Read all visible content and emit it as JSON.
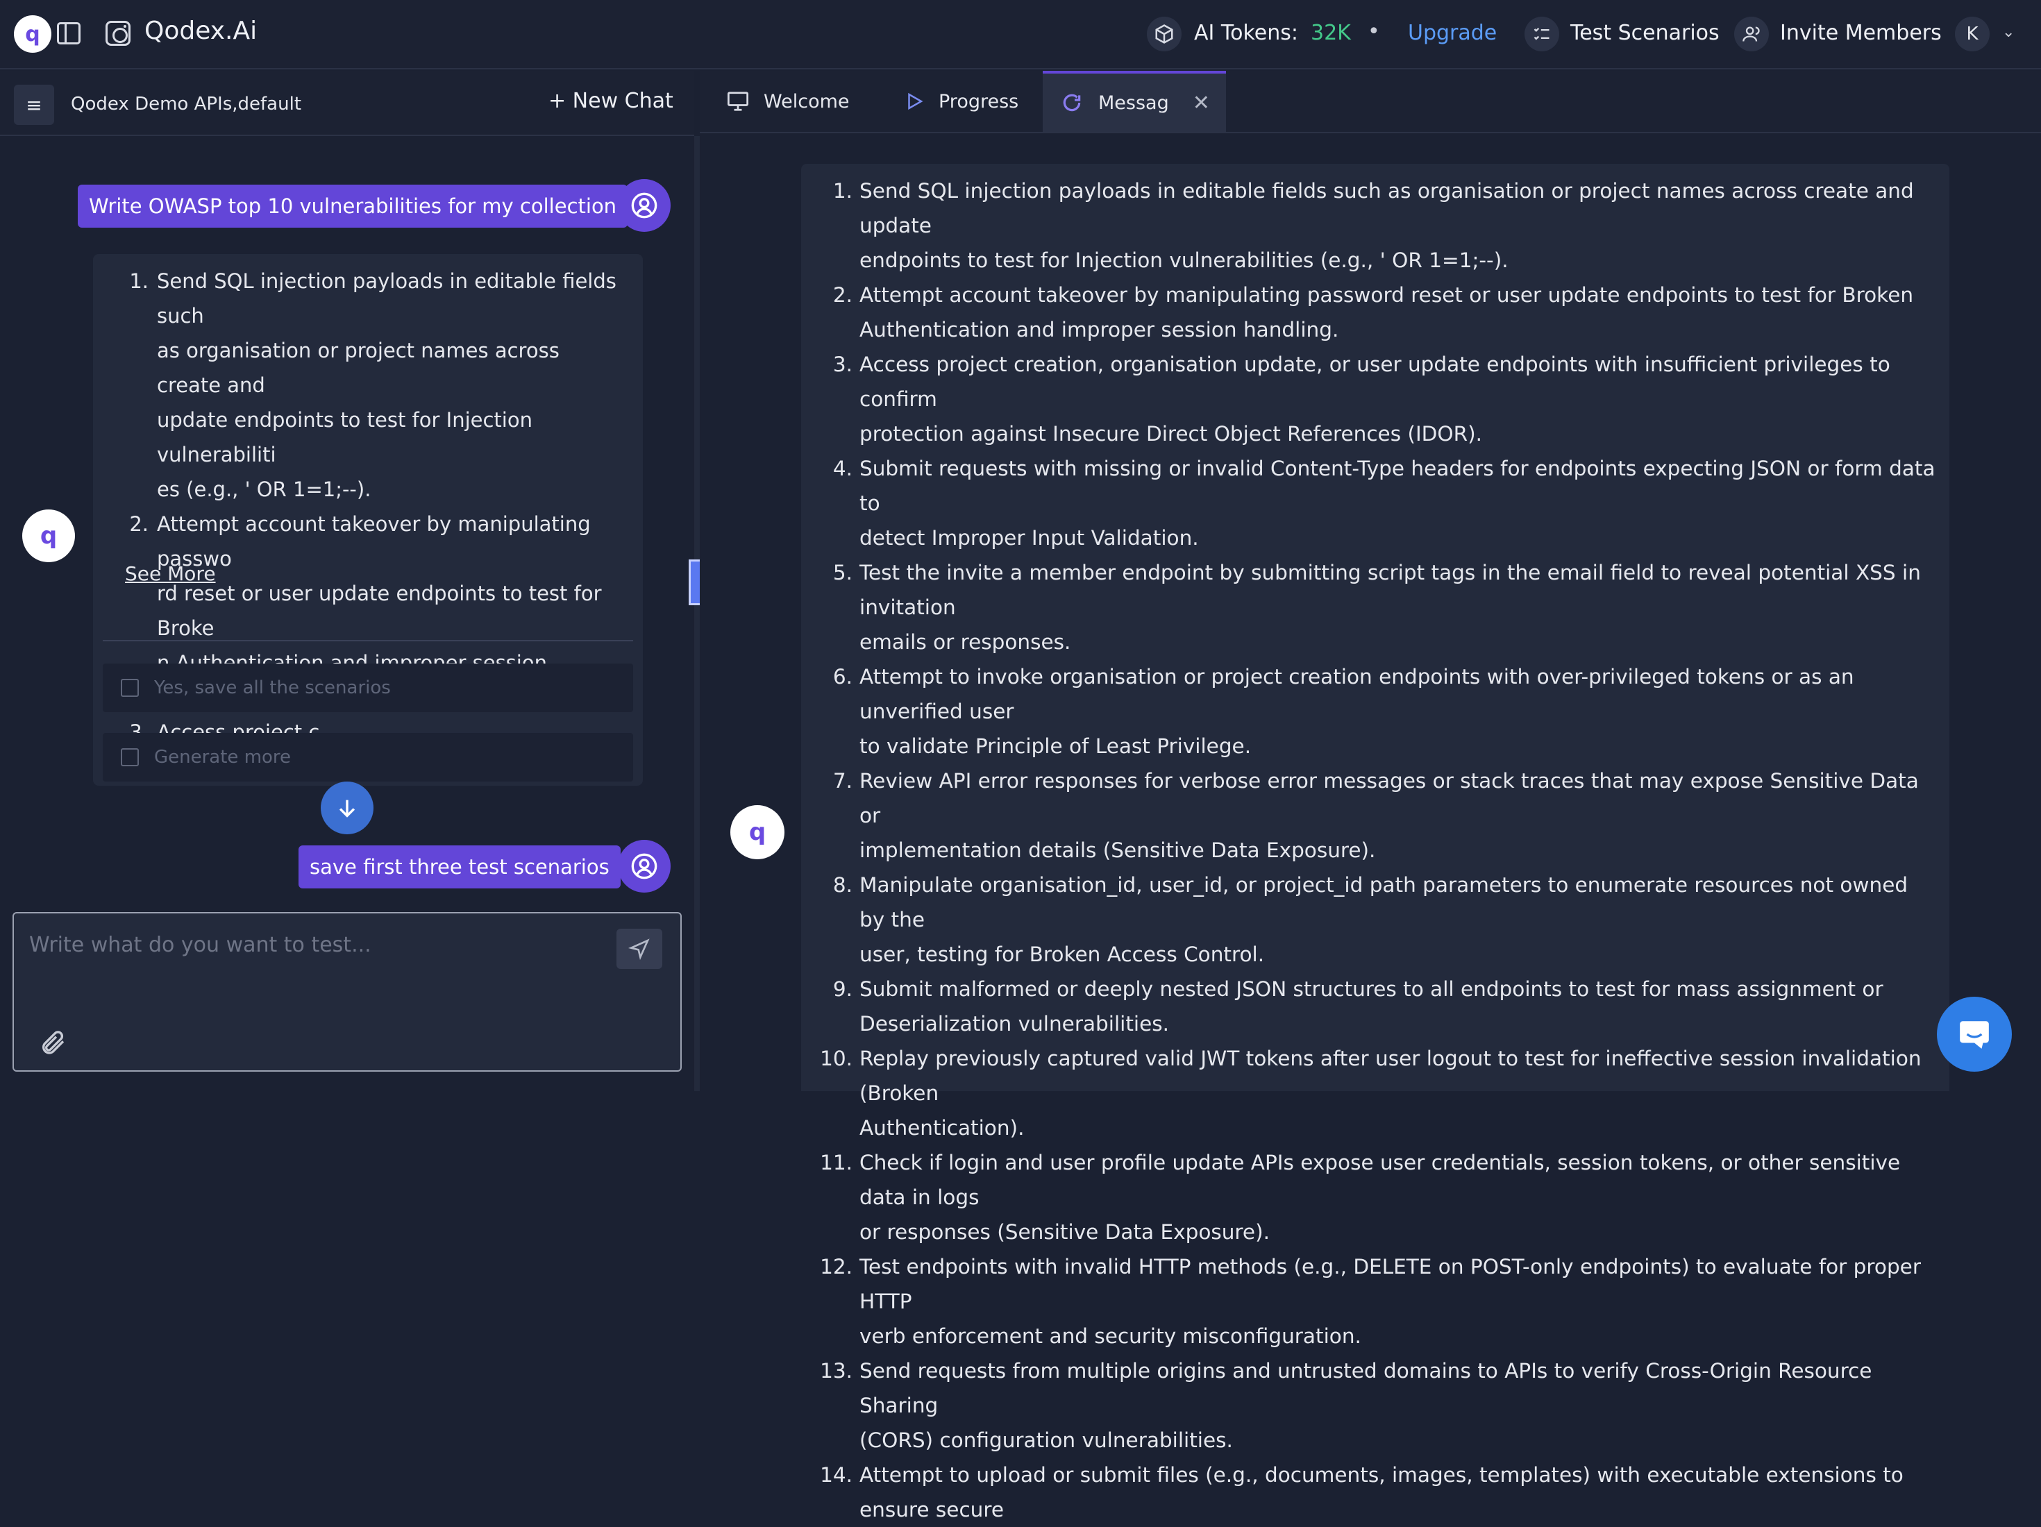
{
  "topbar": {
    "logo_letter": "q",
    "brand": "Qodex.Ai",
    "tokens_label": "AI Tokens:",
    "tokens_value": "32K",
    "separator": "•",
    "upgrade": "Upgrade",
    "test_scenarios": "Test Scenarios",
    "invite_members": "Invite Members",
    "avatar_initial": "K",
    "accent_color": "#6346d8",
    "tokens_color": "#44c98a",
    "link_color": "#5b9cf6"
  },
  "left": {
    "menu_icon": "≡",
    "collection": "Qodex Demo APIs,default",
    "new_chat": "+ New Chat",
    "messages": {
      "first_user": "Write OWASP top 10 vulnerabilities for my collection",
      "second_user": "save first three test scenarios"
    },
    "bot_list": [
      {
        "num": "1.",
        "lines": [
          "Send SQL injection payloads in editable fields such",
          "as organisation or project names across create and",
          "update endpoints to test for Injection vulnerabiliti",
          "es (e.g., ' OR 1=1;--)."
        ]
      },
      {
        "num": "2.",
        "lines": [
          "Attempt account takeover by manipulating passwo",
          "rd reset or user update endpoints to test for Broke",
          "n Authentication and improper session handling."
        ]
      },
      {
        "num": "3.",
        "lines": [
          "Access project c..."
        ]
      }
    ],
    "see_more": "See More",
    "suggestions": [
      "Yes, save all the scenarios",
      "Generate more"
    ],
    "composer_placeholder": "Write what do you want to test..."
  },
  "tabs": [
    {
      "label": "Welcome",
      "icon": "monitor-icon"
    },
    {
      "label": "Progress",
      "icon": "play-icon"
    },
    {
      "label": "Messag",
      "icon": "refresh-icon",
      "active": true
    }
  ],
  "right": {
    "scenarios": [
      {
        "num": "1.",
        "lines": [
          "Send SQL injection payloads in editable fields such as organisation or project names across create and update",
          "endpoints to test for Injection vulnerabilities (e.g., ' OR 1=1;--)."
        ]
      },
      {
        "num": "2.",
        "lines": [
          "Attempt account takeover by manipulating password reset or user update endpoints to test for Broken",
          "Authentication and improper session handling."
        ]
      },
      {
        "num": "3.",
        "lines": [
          "Access project creation, organisation update, or user update endpoints with insufficient privileges to confirm",
          "protection against Insecure Direct Object References (IDOR)."
        ]
      },
      {
        "num": "4.",
        "lines": [
          "Submit requests with missing or invalid Content-Type headers for endpoints expecting JSON or form data to",
          "detect Improper Input Validation."
        ]
      },
      {
        "num": "5.",
        "lines": [
          "Test the invite a member endpoint by submitting script tags in the email field to reveal potential XSS in invitation",
          "emails or responses."
        ]
      },
      {
        "num": "6.",
        "lines": [
          "Attempt to invoke organisation or project creation endpoints with over-privileged tokens or as an unverified user",
          "to validate Principle of Least Privilege."
        ]
      },
      {
        "num": "7.",
        "lines": [
          "Review API error responses for verbose error messages or stack traces that may expose Sensitive Data or",
          "implementation details (Sensitive Data Exposure)."
        ]
      },
      {
        "num": "8.",
        "lines": [
          "Manipulate organisation_id, user_id, or project_id path parameters to enumerate resources not owned by the",
          "user, testing for Broken Access Control."
        ]
      },
      {
        "num": "9.",
        "lines": [
          "Submit malformed or deeply nested JSON structures to all endpoints to test for mass assignment or",
          "Deserialization vulnerabilities."
        ]
      },
      {
        "num": "10.",
        "lines": [
          "Replay previously captured valid JWT tokens after user logout to test for ineffective session invalidation (Broken",
          "Authentication)."
        ]
      },
      {
        "num": "11.",
        "lines": [
          "Check if login and user profile update APIs expose user credentials, session tokens, or other sensitive data in logs",
          "or responses (Sensitive Data Exposure)."
        ]
      },
      {
        "num": "12.",
        "lines": [
          "Test endpoints with invalid HTTP methods (e.g., DELETE on POST-only endpoints) to evaluate for proper HTTP",
          "verb enforcement and security misconfiguration."
        ]
      },
      {
        "num": "13.",
        "lines": [
          "Send requests from multiple origins and untrusted domains to APIs to verify Cross-Origin Resource Sharing",
          "(CORS) configuration vulnerabilities."
        ]
      },
      {
        "num": "14.",
        "lines": [
          "Attempt to upload or submit files (e.g., documents, images, templates) with executable extensions to ensure secure"
        ]
      }
    ]
  }
}
